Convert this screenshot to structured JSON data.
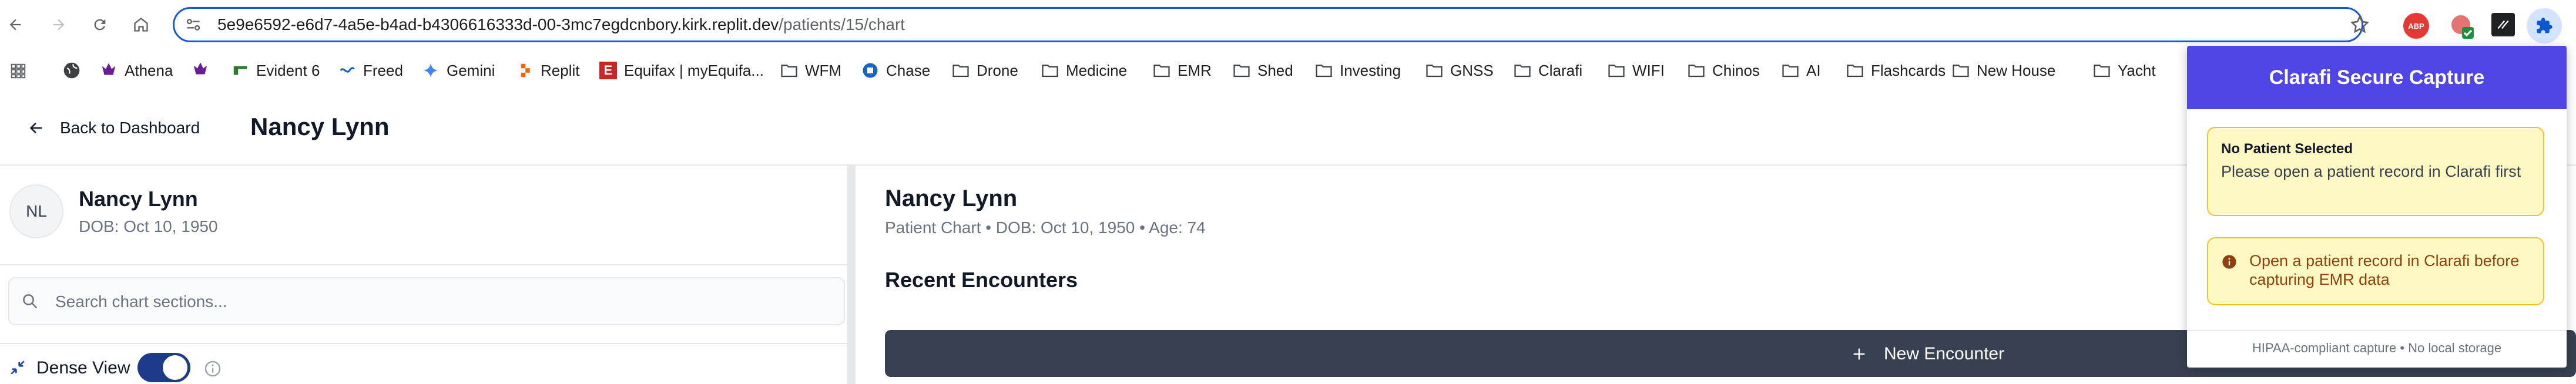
{
  "browser": {
    "url_host": "5e9e6592-e6d7-4a5e-b4ad-b4306616333d-00-3mc7egdcnbory.kirk.replit.dev",
    "url_path": "/patients/15/chart",
    "bookmarks": [
      {
        "label": "Athena",
        "icon": "athena-icon"
      },
      {
        "label": "Evident 6",
        "icon": "evident-icon"
      },
      {
        "label": "Freed",
        "icon": "freed-icon"
      },
      {
        "label": "Gemini",
        "icon": "gemini-icon"
      },
      {
        "label": "Replit",
        "icon": "replit-icon"
      },
      {
        "label": "Equifax | myEquifa...",
        "icon": "equifax-icon"
      },
      {
        "label": "WFM",
        "icon": "folder-icon"
      },
      {
        "label": "Chase",
        "icon": "chase-icon"
      },
      {
        "label": "Drone",
        "icon": "folder-icon"
      },
      {
        "label": "Medicine",
        "icon": "folder-icon"
      },
      {
        "label": "EMR",
        "icon": "folder-icon"
      },
      {
        "label": "Shed",
        "icon": "folder-icon"
      },
      {
        "label": "Investing",
        "icon": "folder-icon"
      },
      {
        "label": "GNSS",
        "icon": "folder-icon"
      },
      {
        "label": "Clarafi",
        "icon": "folder-icon"
      },
      {
        "label": "WIFI",
        "icon": "folder-icon"
      },
      {
        "label": "Chinos",
        "icon": "folder-icon"
      },
      {
        "label": "AI",
        "icon": "folder-icon"
      },
      {
        "label": "Flashcards",
        "icon": "folder-icon"
      },
      {
        "label": "New House",
        "icon": "folder-icon"
      },
      {
        "label": "Yacht",
        "icon": "folder-icon"
      }
    ],
    "extension_badge": "ABP"
  },
  "header": {
    "back_label": "Back to Dashboard",
    "patient_name": "Nancy Lynn"
  },
  "sidebar": {
    "initials": "NL",
    "name": "Nancy Lynn",
    "dob": "DOB: Oct 10, 1950",
    "search_placeholder": "Search chart sections...",
    "dense_view_label": "Dense View"
  },
  "main": {
    "name": "Nancy Lynn",
    "subtitle": "Patient Chart • DOB: Oct 10, 1950 • Age: 74",
    "section_title": "Recent Encounters",
    "new_encounter_label": "New Encounter"
  },
  "popup": {
    "title": "Clarafi Secure Capture",
    "status_title": "No Patient Selected",
    "status_text": "Please open a patient record in Clarafi first",
    "warning_text": "Open a patient record in Clarafi before capturing EMR data",
    "footer": "HIPAA-compliant capture • No local storage"
  },
  "colors": {
    "accent": "#4f46e5",
    "omnibox_border": "#1a57d2",
    "button_dark": "#374151",
    "warning_bg": "#fef9c3",
    "warning_border": "#fbbf24",
    "toggle_on": "#1e3a8a"
  }
}
